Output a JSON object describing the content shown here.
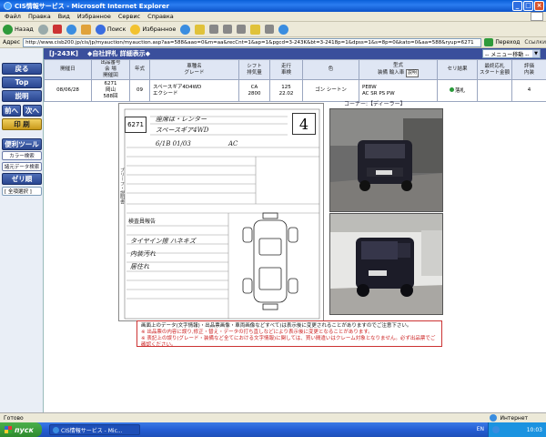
{
  "window": {
    "title": "CIS情報サービス - Microsoft Internet Explorer",
    "buttons": [
      "_",
      "□",
      "×"
    ]
  },
  "menu": [
    "Файл",
    "Правка",
    "Вид",
    "Избранное",
    "Сервис",
    "Справка"
  ],
  "toolbar": {
    "back_label": "Назад",
    "search_label": "Поиск",
    "favorites_label": "Избранное"
  },
  "address": {
    "label": "Адрес",
    "url": "http://www.cisb200.jp/cis/jp/myauction/myauction.asp?aa=588&aao=0&m=aa&recCnt=1&ap=1&pgcd=3-243K&bt=3-2418p=1&dpss=1&s=8p=0&kato=0&aa=588&ryup=6271",
    "go_label": "Переход",
    "links_label": "Ссылки"
  },
  "leftnav": {
    "back": "戻る",
    "top": "Top",
    "help": "説明",
    "prev": "前へ",
    "next": "次へ",
    "print": "印 刷",
    "tools": "便利ツール",
    "color": "カラー検索",
    "fav": "諸元データ検索",
    "bid": "ゼリ順",
    "select": "[ 全項選択 ]"
  },
  "strip": {
    "code": "[J-243K]",
    "title": "◆自社評札 詳細表示◆",
    "menu_select": "-- メニュー移動 --"
  },
  "table": {
    "headers": [
      "開催日",
      "出品番号\n会 場\n開催回",
      "年式",
      "車種名\nグレード",
      "シフト\n排気量",
      "走行\n車検",
      "色",
      "型式\n装備",
      "セリ結果",
      "最終応札\nスタート金額",
      "評価\n内装"
    ],
    "inspect_label": "輸入車",
    "help_label": "説明",
    "row": {
      "date": "08/06/28",
      "lot": "6271",
      "venue": "岡山",
      "session": "588回",
      "year": "09",
      "model": "スペースギア4D4WD",
      "grade": "エクシード",
      "shift": "CA",
      "cc": "2800",
      "mileage": "125",
      "inspection": "22.02",
      "color": "ゴン  シートン",
      "type": "PE8W",
      "equipment": "AC SR PS PW",
      "result": "落札",
      "score": "4"
    }
  },
  "sheet": {
    "lot": "6271",
    "grade": "4",
    "hand1": "座席は・レンター",
    "hand2": "スペースギア4WD",
    "hand3": "6/1B 01/03",
    "hand4": "AC",
    "report_label": "検査員報告",
    "hand5": "タイヤイン擦  ハネキズ",
    "hand6": "内装汚れ",
    "hand7": "居住れ",
    "vertical": "ブリーフ・説明書"
  },
  "photos": {
    "corner_label": "コーナー:【ディーラー】"
  },
  "notice": {
    "line1": "画面上のデータ(文字情報)・出品票画像・車両画像などすべて)は表示後に変更されることがありますのでご注意下さい。",
    "line2": "※ 出品票の内容に誤り,修正・替え・データの打ち直しなどにより表示後に変更となることがあります。",
    "line3": "※ 表記上の誤り(グレード・装備など全てにおける文字情報)に関しては、買い間違いはクレーム対象となりません。必ず出品票でご確認ください。"
  },
  "status": {
    "left": "Готово",
    "zone": "Интернет"
  },
  "taskbar": {
    "start": "пуск",
    "task": "CIS情報サービス - Mic...",
    "lang": "EN",
    "clock": "10:03"
  }
}
